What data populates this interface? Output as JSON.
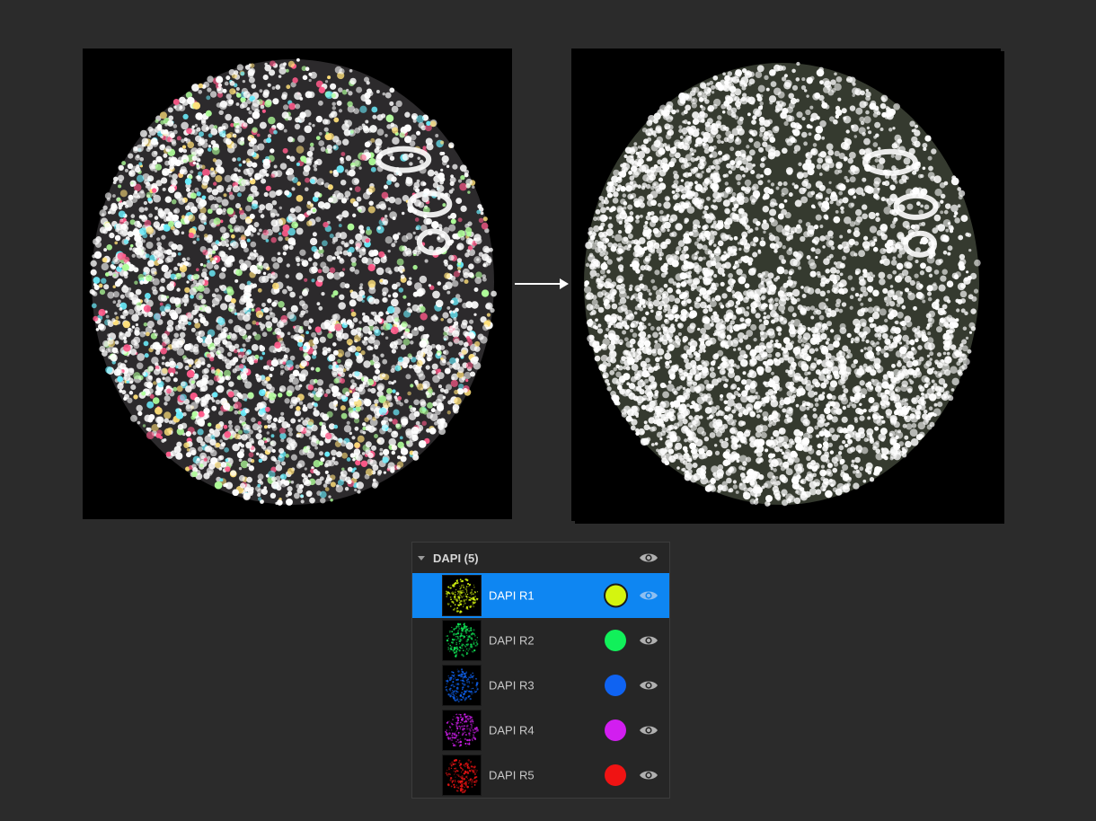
{
  "colors": {
    "background": "#2b2b2b",
    "selection": "#0e86f2",
    "eye": "#a9a9a9"
  },
  "images": {
    "before_panel": {
      "description_icon": "raw-multichannel-dapi-image"
    },
    "after_panel": {
      "description_icon": "registered-dapi-image"
    }
  },
  "arrow_icon": "right-arrow-icon",
  "layers_panel": {
    "group": {
      "title": "DAPI (5)",
      "expanded": true,
      "visible": true
    },
    "items": [
      {
        "label": "DAPI R1",
        "color": "#d4f50f",
        "visible": true,
        "selected": true
      },
      {
        "label": "DAPI R2",
        "color": "#11f05a",
        "visible": true,
        "selected": false
      },
      {
        "label": "DAPI R3",
        "color": "#0f63f2",
        "visible": true,
        "selected": false
      },
      {
        "label": "DAPI R4",
        "color": "#d21ef0",
        "visible": true,
        "selected": false
      },
      {
        "label": "DAPI R5",
        "color": "#f01313",
        "visible": true,
        "selected": false
      }
    ]
  }
}
